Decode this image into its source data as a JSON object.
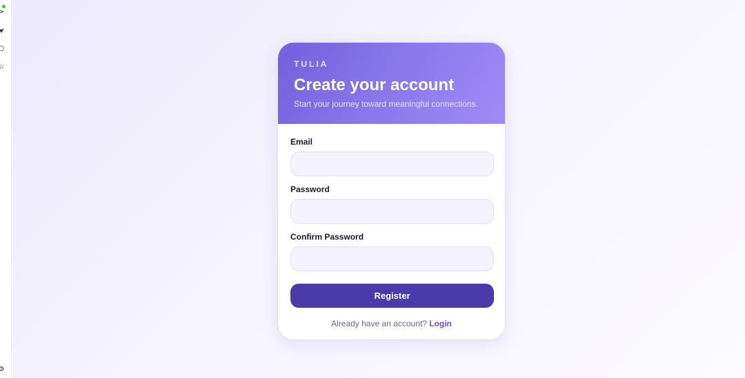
{
  "sidebar": {
    "icons": [
      "chevron-right-icon",
      "bell-icon",
      "circle-icon",
      "star-icon",
      "settings-icon"
    ]
  },
  "card": {
    "brand": "TULIA",
    "title": "Create your account",
    "subtitle": "Start your journey toward meaningful connections."
  },
  "form": {
    "email_label": "Email",
    "email_value": "",
    "password_label": "Password",
    "password_value": "",
    "confirm_label": "Confirm Password",
    "confirm_value": "",
    "register_label": "Register"
  },
  "footer": {
    "prompt": "Already have an account?",
    "login_label": "Login"
  },
  "colors": {
    "accent": "#4b3aaa",
    "header_gradient_start": "#7360dc",
    "header_gradient_end": "#a08bf6",
    "link": "#6a4fd3",
    "status_dot": "#3cc43c"
  }
}
